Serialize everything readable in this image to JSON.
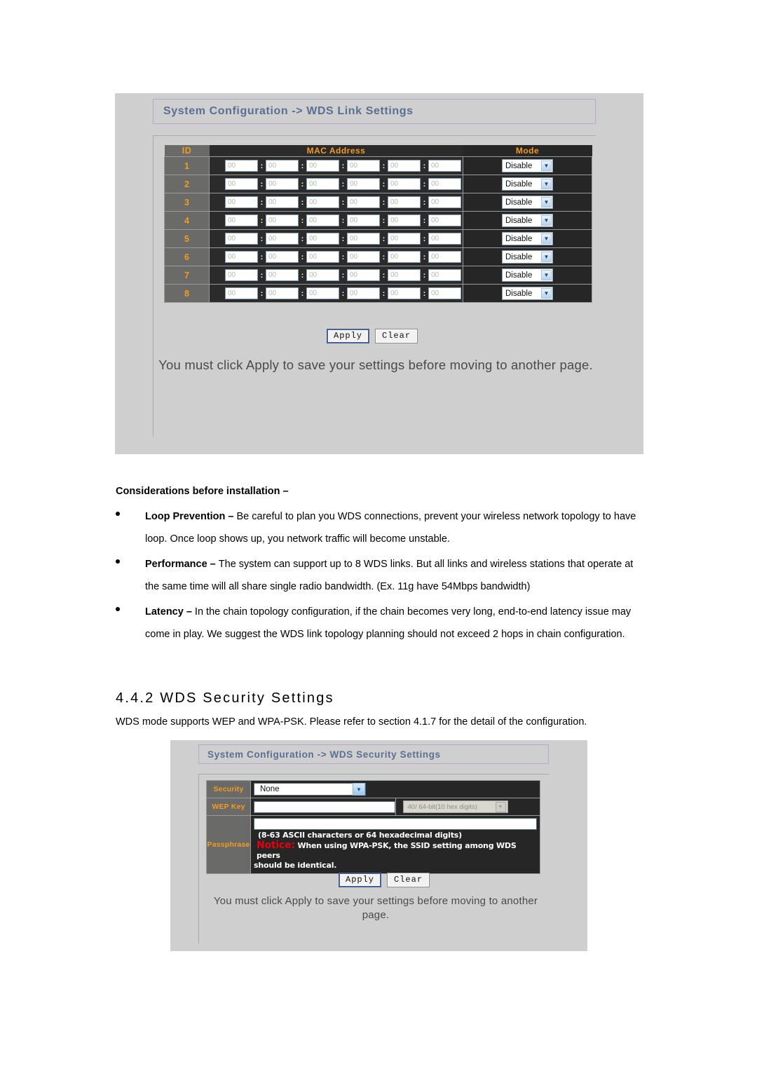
{
  "panel1": {
    "title": "System Configuration -> WDS Link Settings",
    "columns": {
      "id": "ID",
      "mac": "MAC Address",
      "mode": "Mode"
    },
    "rows": [
      {
        "id": "1",
        "mac": [
          "00",
          "00",
          "00",
          "00",
          "00",
          "00"
        ],
        "mode": "Disable"
      },
      {
        "id": "2",
        "mac": [
          "00",
          "00",
          "00",
          "00",
          "00",
          "00"
        ],
        "mode": "Disable"
      },
      {
        "id": "3",
        "mac": [
          "00",
          "00",
          "00",
          "00",
          "00",
          "00"
        ],
        "mode": "Disable"
      },
      {
        "id": "4",
        "mac": [
          "00",
          "00",
          "00",
          "00",
          "00",
          "00"
        ],
        "mode": "Disable"
      },
      {
        "id": "5",
        "mac": [
          "00",
          "00",
          "00",
          "00",
          "00",
          "00"
        ],
        "mode": "Disable"
      },
      {
        "id": "6",
        "mac": [
          "00",
          "00",
          "00",
          "00",
          "00",
          "00"
        ],
        "mode": "Disable"
      },
      {
        "id": "7",
        "mac": [
          "00",
          "00",
          "00",
          "00",
          "00",
          "00"
        ],
        "mode": "Disable"
      },
      {
        "id": "8",
        "mac": [
          "00",
          "00",
          "00",
          "00",
          "00",
          "00"
        ],
        "mode": "Disable"
      }
    ],
    "separator": ":",
    "apply_label": "Apply",
    "clear_label": "Clear",
    "note": "You must click Apply to save your settings before moving to another page."
  },
  "doc": {
    "considerations_heading": "Considerations before installation –",
    "bullets": [
      {
        "term": "Loop Prevention – ",
        "text": "Be careful to plan you WDS connections, prevent your wireless network topology to have loop. Once loop shows up, you network traffic will become unstable."
      },
      {
        "term": "Performance – ",
        "text": "The system can support up to 8 WDS links. But all links and wireless stations that operate at the same time will all share single radio bandwidth. (Ex. 11g have 54Mbps bandwidth)"
      },
      {
        "term": "Latency – ",
        "text": "In the chain topology configuration, if the chain becomes very long, end-to-end latency issue may come in play. We suggest the WDS link topology planning should not exceed 2 hops in chain configuration."
      }
    ],
    "section_number_title": "4.4.2 WDS Security Settings",
    "section_intro": "WDS mode supports WEP and WPA-PSK. Please refer to section 4.1.7 for the detail of the configuration."
  },
  "panel2": {
    "title": "System Configuration -> WDS Security Settings",
    "security_label": "Security",
    "security_value": "None",
    "wepkey_label": "WEP Key",
    "wepkey_value": "",
    "wepkey_size_value": "40/ 64-bit(10 hex digits)",
    "passphrase_label": "Passphrase",
    "passphrase_value": "",
    "passphrase_hint": "(8-63 ASCII characters or 64 hexadecimal digits)",
    "notice_word": "Notice:",
    "notice_text": " When using WPA-PSK, the SSID setting among WDS peers",
    "notice_text2": "should be identical.",
    "apply_label": "Apply",
    "clear_label": "Clear",
    "note": "You must click Apply to save your settings before moving to another page."
  },
  "colors": {
    "panel_bg": "#cfcfcf",
    "header_cell": "#6a6a68",
    "accent_orange": "#f59b1e",
    "dark_cell": "#262626",
    "title_blue": "#5a6f94",
    "notice_red": "#e8000c"
  }
}
